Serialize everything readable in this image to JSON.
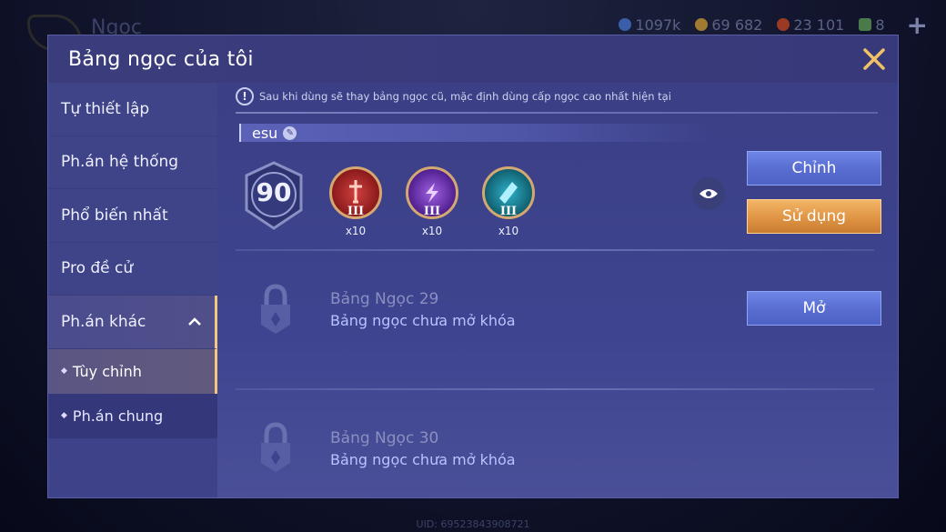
{
  "background": {
    "title": "Ngọc",
    "resources": [
      {
        "value": "1097k",
        "icon": "gem-icon",
        "color": "#4a7ad0"
      },
      {
        "value": "69 682",
        "icon": "gold-coin-icon",
        "color": "#d0a040"
      },
      {
        "value": "23 101",
        "icon": "voucher-icon",
        "color": "#c05030"
      },
      {
        "value": "8",
        "icon": "ticket-icon",
        "color": "#60a060"
      }
    ],
    "uid": "UID: 69523843908721"
  },
  "modal": {
    "title": "Bảng ngọc của tôi",
    "close_icon": "close-icon"
  },
  "sidebar": {
    "items": [
      {
        "label": "Tự thiết lập"
      },
      {
        "label": "Ph.án hệ thống"
      },
      {
        "label": "Phổ biến nhất"
      },
      {
        "label": "Pro đề cử"
      },
      {
        "label": "Ph.án khác"
      }
    ],
    "sub_items": [
      {
        "label": "Tùy chỉnh",
        "active": true
      },
      {
        "label": "Ph.án chung",
        "active": false
      }
    ]
  },
  "content": {
    "notice": "Sau khi dùng sẽ thay bảng ngọc cũ, mặc định dùng cấp ngọc cao nhất hiện tại",
    "page_name": "esu",
    "level": "90",
    "runes": [
      {
        "tier": "III",
        "count": "x10",
        "color": "#c03030",
        "icon": "red-sword-rune-icon"
      },
      {
        "tier": "III",
        "count": "x10",
        "color": "#8040c0",
        "icon": "purple-lightning-rune-icon"
      },
      {
        "tier": "III",
        "count": "x10",
        "color": "#2090a8",
        "icon": "teal-crystal-rune-icon"
      }
    ],
    "edit_label": "Chỉnh",
    "use_label": "Sử dụng",
    "locked": [
      {
        "title": "Bảng Ngọc 29",
        "subtitle": "Bảng ngọc chưa mở khóa",
        "button": "Mở"
      },
      {
        "title": "Bảng Ngọc 30",
        "subtitle": "Bảng ngọc chưa mở khóa"
      }
    ]
  }
}
